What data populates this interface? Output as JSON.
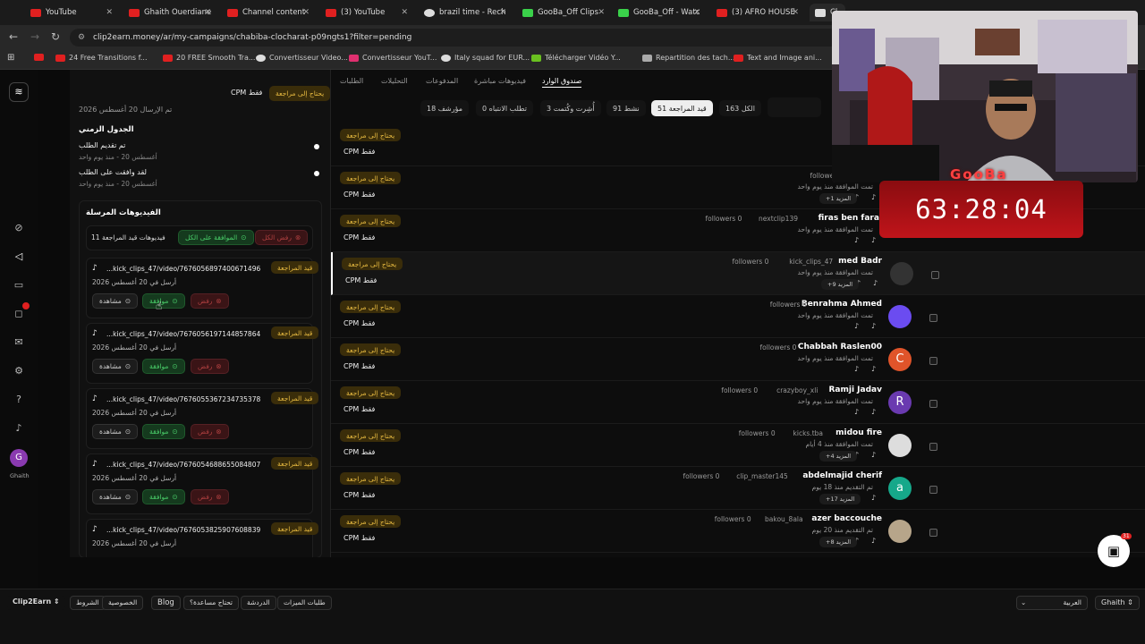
{
  "browser": {
    "tabs": [
      {
        "label": "YouTube",
        "color": "#e02020"
      },
      {
        "label": "Ghaith Ouerdiane",
        "color": "#e02020"
      },
      {
        "label": "Channel content",
        "color": "#e02020"
      },
      {
        "label": "(3) YouTube",
        "color": "#e02020"
      },
      {
        "label": "brazil time - Rech",
        "color": "#dddddd"
      },
      {
        "label": "GooBa_Off Clips",
        "color": "#3ad14a"
      },
      {
        "label": "GooBa_Off - Watc",
        "color": "#3ad14a"
      },
      {
        "label": "(3) AFRO HOUSE",
        "color": "#e02020"
      },
      {
        "label": "Cl",
        "color": "#dddddd"
      }
    ],
    "url": "clip2earn.money/ar/my-campaigns/chabiba-clocharat-p09ngts1?filter=pending",
    "bookmarks": [
      "24 Free Transitions f...",
      "20 FREE Smooth Tra...",
      "Convertisseur Video...",
      "Convertisseur YouT...",
      "Italy squad for EUR...",
      "Télécharger Vidéo Y...",
      "Repartition des tach...",
      "Text and Image ani..."
    ]
  },
  "rail": {
    "user_initial": "G",
    "user_name": "Ghaith",
    "badge_color": "#e02020"
  },
  "detail": {
    "top_status": "يحتاج إلى مراجعة",
    "top_cpm": "CPM فقط",
    "sent_date": "تم الإرسال 20 أغسطس 2026",
    "timeline_title": "الجدول الزمني",
    "timeline": [
      {
        "label": "تم تقديم الطلب",
        "date": "أغسطس 20 - منذ يوم واحد"
      },
      {
        "label": "لقد وافقت على الطلب",
        "date": "أغسطس 20 - منذ يوم واحد"
      }
    ],
    "videos_title": "الفيديوهات المرسلة",
    "pending_count": "11 فيديوهات قيد المراجعة",
    "approve_all": "الموافقة على الكل",
    "reject_all": "رفض الكل",
    "videos": [
      {
        "url": "...kick_clips_47/video/7676056897400671496",
        "status": "قيد المراجعة",
        "sent": "أرسل في 20 أغسطس 2026"
      },
      {
        "url": "...kick_clips_47/video/7676056197144857864",
        "status": "قيد المراجعة",
        "sent": "أرسل في 20 أغسطس 2026"
      },
      {
        "url": "...kick_clips_47/video/7676055367234735378",
        "status": "قيد المراجعة",
        "sent": "أرسل في 20 أغسطس 2026"
      },
      {
        "url": "...kick_clips_47/video/7676054688655084807",
        "status": "قيد المراجعة",
        "sent": "أرسل في 20 أغسطس 2026"
      },
      {
        "url": "...kick_clips_47/video/7676053825907608839",
        "status": "قيد المراجعة",
        "sent": "أرسل في 20 أغسطس 2026"
      }
    ],
    "view_label": "مشاهدة",
    "approve_label": "موافقة",
    "reject_label": "رفض"
  },
  "list": {
    "tabs": [
      "صندوق الوارد",
      "فيديوهات مباشرة",
      "المدفوعات",
      "التحليلات",
      "الطلبات"
    ],
    "filters": [
      "الكل 163",
      "قيد المراجعة 51",
      "نشط 91",
      "أُشِرت وكُتمت 3",
      "تطلب الانتباه 0",
      "مؤرشف 18"
    ],
    "status_label": "يحتاج إلى مراجعة",
    "cpm_label": "CPM فقط",
    "rows": [
      {
        "name": "",
        "handle": "",
        "followers": "followers 0",
        "meta": "ساعات تقريباً",
        "more": "",
        "avatar": "",
        "avatar_color": "#000000"
      },
      {
        "name": "Mou...",
        "handle": "",
        "followers": "followers 0",
        "meta": "تمت الموافقة منذ يوم واحد",
        "more": "+1 المزيد",
        "avatar": "",
        "avatar_color": "#000000"
      },
      {
        "name": "firas ben faral",
        "handle": "nextclip139",
        "followers": "followers 0",
        "meta": "تمت الموافقة منذ يوم واحد",
        "more": "",
        "avatar": "",
        "avatar_color": "#000000"
      },
      {
        "name": "med Badr",
        "handle": "kick_clips_47",
        "followers": "followers 0",
        "meta": "تمت الموافقة منذ يوم واحد",
        "more": "+9 المزيد",
        "avatar": "img",
        "avatar_color": "#333333"
      },
      {
        "name": "Benrahma Ahmed",
        "handle": "",
        "followers": "followers 0",
        "meta": "تمت الموافقة منذ يوم واحد",
        "more": "",
        "avatar": "",
        "avatar_color": "#6b4cf0"
      },
      {
        "name": "Chabbah Raslen00",
        "handle": "",
        "followers": "followers 0",
        "meta": "تمت الموافقة منذ يوم واحد",
        "more": "",
        "avatar": "C",
        "avatar_color": "#e0542a"
      },
      {
        "name": "Ramji Jadav",
        "handle": "crazyboy_xli",
        "followers": "followers 0",
        "meta": "تمت الموافقة منذ يوم واحد",
        "more": "",
        "avatar": "R",
        "avatar_color": "#6a3ab0"
      },
      {
        "name": "midou fire",
        "handle": "kicks.tba",
        "followers": "followers 0",
        "meta": "تمت الموافقة منذ 4 أيام",
        "more": "+4 المزيد",
        "avatar": "img",
        "avatar_color": "#dddddd"
      },
      {
        "name": "abdelmajid cherif",
        "handle": "clip_master145",
        "followers": "followers 0",
        "meta": "تم التقديم منذ 18 يوم",
        "more": "+17 المزيد",
        "avatar": "a",
        "avatar_color": "#16a88a"
      },
      {
        "name": "azer baccouche",
        "handle": "bakou_8ala",
        "followers": "followers 0",
        "meta": "تم التقديم منذ 20 يوم",
        "more": "+8 المزيد",
        "avatar": "img",
        "avatar_color": "#b7a58a"
      }
    ]
  },
  "footer": {
    "brand": "Clip2Earn",
    "links": [
      "الشروط",
      "الخصوصية",
      "Blog",
      "تحتاج مساعدة؟",
      "الدردشة",
      "طلبات الميزات"
    ],
    "language": "العربية",
    "user": "Ghaith"
  },
  "overlay": {
    "timer": "63:28:04",
    "logo": "GooBa",
    "chat_badge": "31"
  }
}
